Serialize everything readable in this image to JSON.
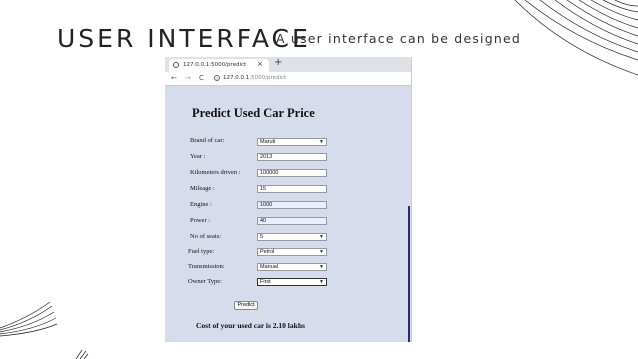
{
  "slide": {
    "title": "USER INTERFACE",
    "subtitle": "A user interface can be designed"
  },
  "browser": {
    "tab_title": "127.0.0.1:5000/predict",
    "tab_close": "×",
    "new_tab": "+",
    "back": "←",
    "forward": "→",
    "reload": "C",
    "info": "i",
    "url_host": "127.0.0.1",
    "url_path": ":5000/predict"
  },
  "form": {
    "heading": "Predict Used Car Price",
    "fields": [
      {
        "label": "Brand of car:",
        "value": "Maruti",
        "type": "select"
      },
      {
        "label": "Year :",
        "value": "2013",
        "type": "input"
      },
      {
        "label": "Kilometers driven :",
        "value": "100000",
        "type": "input"
      },
      {
        "label": "Mileage :",
        "value": "15",
        "type": "input"
      },
      {
        "label": "Engine :",
        "value": "1000",
        "type": "input"
      },
      {
        "label": "Power :",
        "value": "40",
        "type": "input"
      },
      {
        "label": "No of seats:",
        "value": "5",
        "type": "select"
      },
      {
        "label": "Fuel type:",
        "value": "Petrol",
        "type": "select"
      },
      {
        "label": "Transmission:",
        "value": "Manual",
        "type": "select"
      },
      {
        "label": "Owner Type:",
        "value": "First",
        "type": "select"
      }
    ],
    "button": "Predict",
    "result": "Cost of your used car is 2.10 lakhs"
  }
}
